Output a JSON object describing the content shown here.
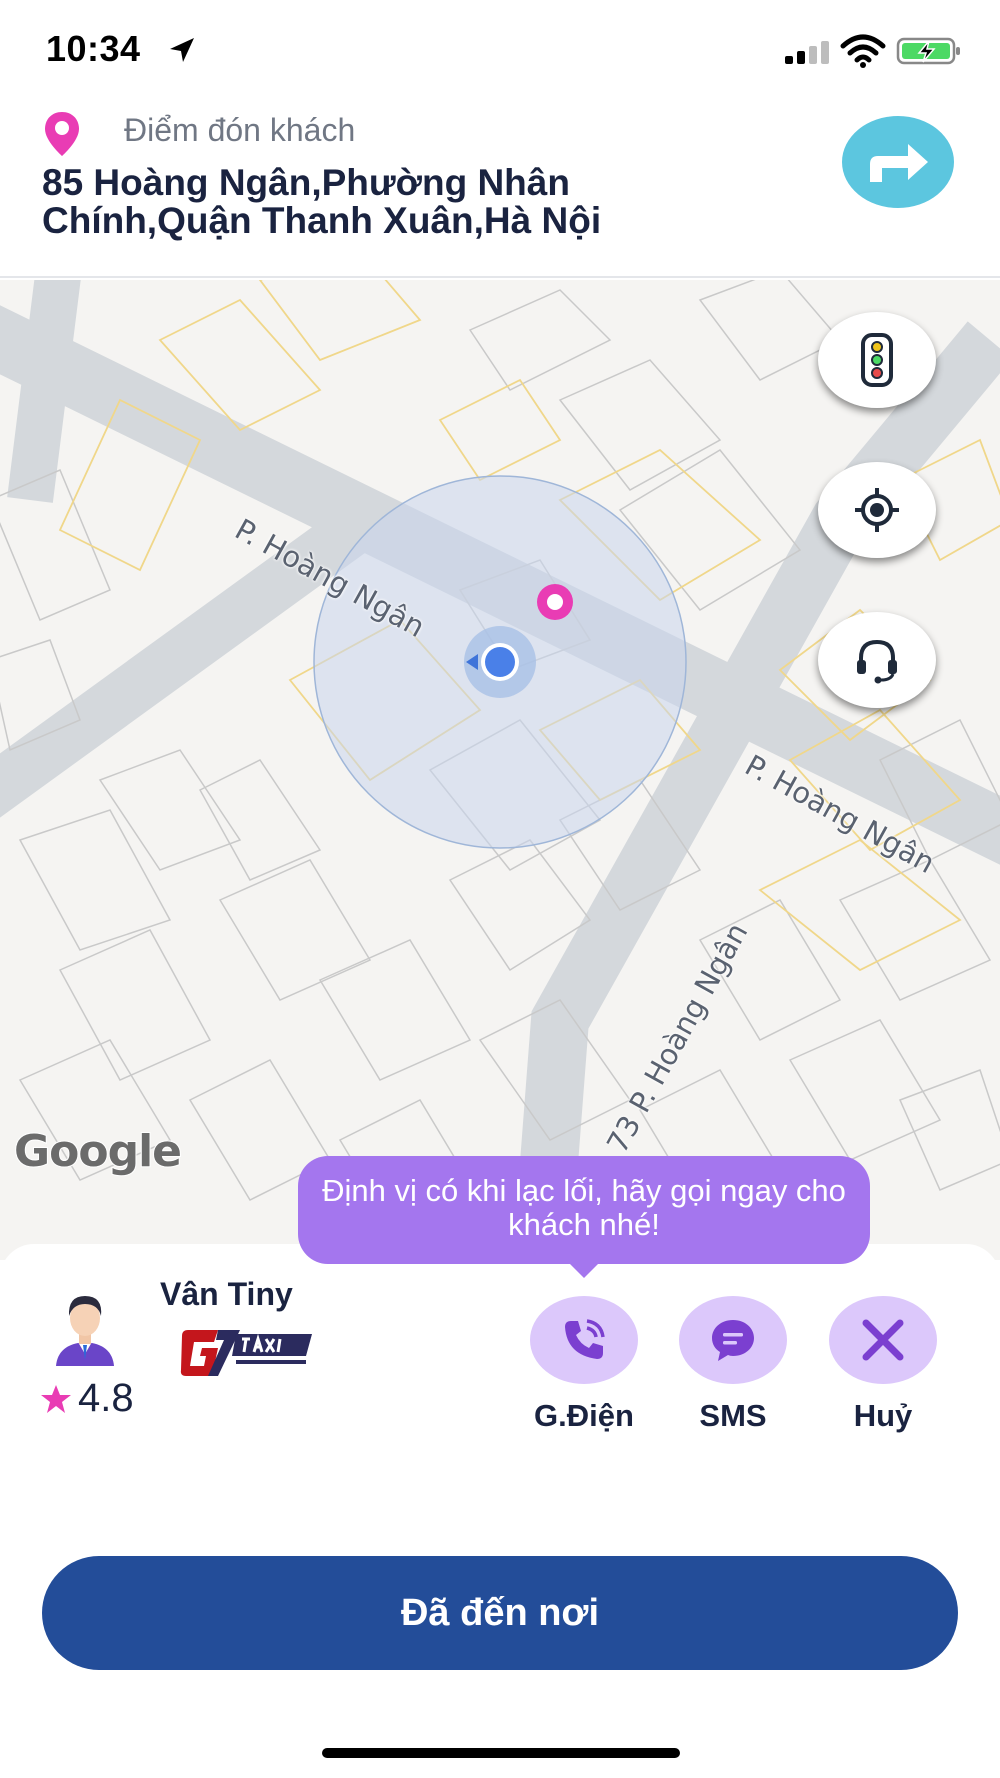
{
  "status_bar": {
    "time": "10:34",
    "icons": [
      "location-arrow-icon",
      "cellular-signal-icon",
      "wifi-icon",
      "battery-charging-icon"
    ]
  },
  "pickup": {
    "label": "Điểm đón khách",
    "address": "85 Hoàng Ngân,Phường Nhân Chính,Quận Thanh Xuân,Hà Nội",
    "pin_icon": "map-pin-icon",
    "pin_color": "#e93cb4",
    "navigate_icon": "turn-right-arrow-icon",
    "navigate_color": "#5cc6df"
  },
  "map": {
    "street_labels": [
      "P. Hoàng Ngân",
      "P. Hoàng Ngân",
      "73 P. Hoàng Ngân"
    ],
    "attribution": "Google",
    "buttons": [
      {
        "icon": "traffic-light-icon"
      },
      {
        "icon": "my-location-icon"
      },
      {
        "icon": "headset-support-icon"
      }
    ]
  },
  "tooltip": {
    "text": "Định vị có khi lạc lối, hãy gọi ngay cho khách nhé!"
  },
  "driver": {
    "name": "Vân Tiny",
    "rating": "4.8",
    "brand": "G7 TAXI",
    "avatar_icon": "driver-avatar-icon"
  },
  "actions": [
    {
      "label": "G.Điện",
      "icon": "phone-icon"
    },
    {
      "label": "SMS",
      "icon": "message-icon"
    },
    {
      "label": "Huỷ",
      "icon": "close-icon"
    }
  ],
  "primary_action": {
    "label": "Đã đến nơi"
  },
  "colors": {
    "accent_purple": "#a476ee",
    "action_bg": "#dcc8fb",
    "action_icon": "#7b3fd0",
    "primary_button": "#234d99",
    "text_dark": "#1a2340"
  }
}
